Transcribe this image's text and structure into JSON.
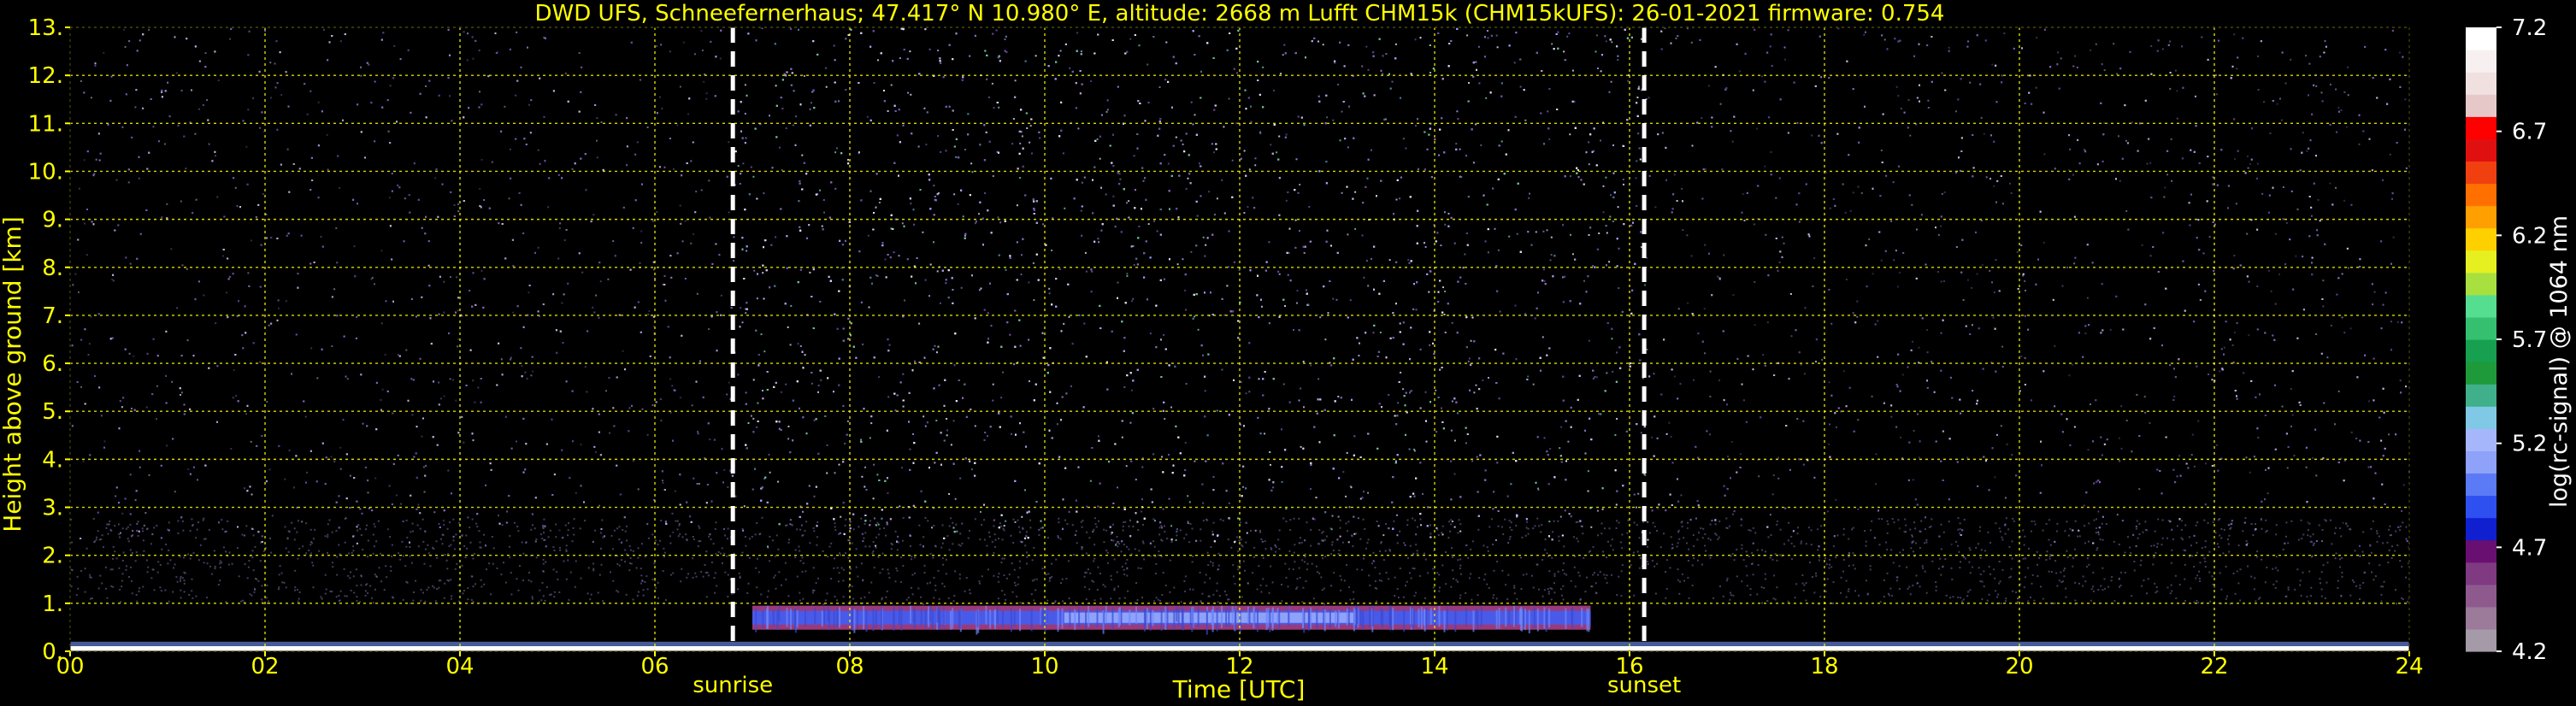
{
  "title": "DWD UFS, Schneefernerhaus; 47.417° N 10.980° E, altitude: 2668 m     Lufft CHM15k (CHM15kUFS): 26-01-2021     firmware: 0.754",
  "chart_data": {
    "type": "heatmap",
    "title": "DWD UFS, Schneefernerhaus; 47.417° N 10.980° E, altitude: 2668 m     Lufft CHM15k (CHM15kUFS): 26-01-2021     firmware: 0.754",
    "xlabel": "Time [UTC]",
    "ylabel": "Height above ground [km]",
    "xlim": [
      0,
      24
    ],
    "ylim": [
      0,
      13
    ],
    "x_ticks": [
      "00",
      "02",
      "04",
      "06",
      "08",
      "10",
      "12",
      "14",
      "16",
      "18",
      "20",
      "22",
      "24"
    ],
    "y_ticks": [
      "0.",
      "1.",
      "2.",
      "3.",
      "4.",
      "5.",
      "6.",
      "7.",
      "8.",
      "9.",
      "10.",
      "11.",
      "12.",
      "13."
    ],
    "grid": true,
    "grid_color": "#ffff00",
    "events": [
      {
        "label": "sunrise",
        "time": 6.8
      },
      {
        "label": "sunset",
        "time": 16.15
      }
    ],
    "layers": [
      {
        "name": "aerosol layer",
        "t_start": 7.0,
        "t_end": 15.6,
        "h_bottom": 0.45,
        "h_top": 0.95,
        "peak_signal": 5.9
      },
      {
        "name": "surface signal",
        "t_start": 0,
        "t_end": 24,
        "h_bottom": 0.0,
        "h_top": 0.2
      }
    ],
    "colorbar": {
      "label": "log(rc-signal) @ 1064 nm",
      "range": [
        4.2,
        7.2
      ],
      "ticks": [
        "7.2",
        "6.7",
        "6.2",
        "5.7",
        "5.2",
        "4.7",
        "4.2"
      ],
      "colors": [
        "#a49aa8",
        "#9b7a9a",
        "#8e5a8e",
        "#7f3a82",
        "#6a0f72",
        "#1020d0",
        "#2e50f0",
        "#5b7af6",
        "#8ea2fa",
        "#a6b6fb",
        "#7fc8e6",
        "#3fb08a",
        "#1f9a3a",
        "#16a050",
        "#35c070",
        "#55dd90",
        "#a8e040",
        "#e6f020",
        "#ffd000",
        "#ffa000",
        "#ff7000",
        "#f04010",
        "#e01010",
        "#ff0000",
        "#e7c8c8",
        "#f0e0e0",
        "#f8f0f0",
        "#ffffff"
      ]
    }
  }
}
